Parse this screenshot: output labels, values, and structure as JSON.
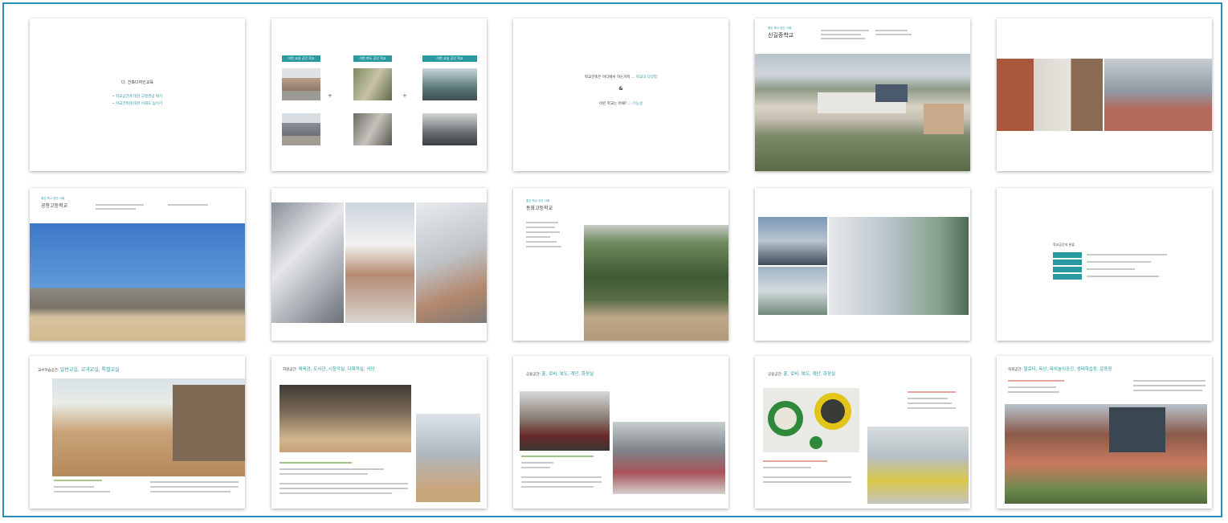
{
  "slides": {
    "s1": {
      "title": "다. 건축디자인교육",
      "line1": "• 학교공간에 대한 고정관념 깨기",
      "line2": "• 학교건축에 대한 이해도 높이기"
    },
    "s2": {
      "head1": "이런 교실 공간 학교",
      "head2": "이런 복도 공간 학교",
      "head3": "이런 교실 공간 학교"
    },
    "s3": {
      "q1": "학교건축은 어디에서 하는거지 …",
      "q1_accent": "학교의 다양함",
      "amp": "&",
      "q2": "이런 학교는 어때? …",
      "q2_accent": "기능성"
    },
    "s4": {
      "title": "신길중학교",
      "sub": "좋은 학교 공간 사례"
    },
    "s6": {
      "title": "공항고등학교",
      "sub": "좋은 학교 공간 사례"
    },
    "s8": {
      "title": "동화고등학교",
      "sub": "좋은 학교 공간 사례"
    },
    "s10": {
      "title": "학교공간의 분류"
    },
    "s11": {
      "title_prefix": "교수학습공간:",
      "title_accent": "일반교실, 교과교실, 특별교실"
    },
    "s12": {
      "title_prefix": "지원공간:",
      "title_accent": "체육관, 도서관, 시청각실, 다목적실, 식당"
    },
    "s13": {
      "title_prefix": "공용공간:",
      "title_accent": "홀, 로비, 복도, 계단, 화장실"
    },
    "s14": {
      "title_prefix": "공용공간:",
      "title_accent": "홀, 로비, 복도, 계단, 화장실"
    },
    "s15": {
      "title_prefix": "옥외공간:",
      "title_accent": "필로티, 옥상, 옥외놀이공간, 생태학습장, 운동장"
    }
  },
  "colors": {
    "frame": "#2a8fb8",
    "accent": "#2a9aa0"
  }
}
